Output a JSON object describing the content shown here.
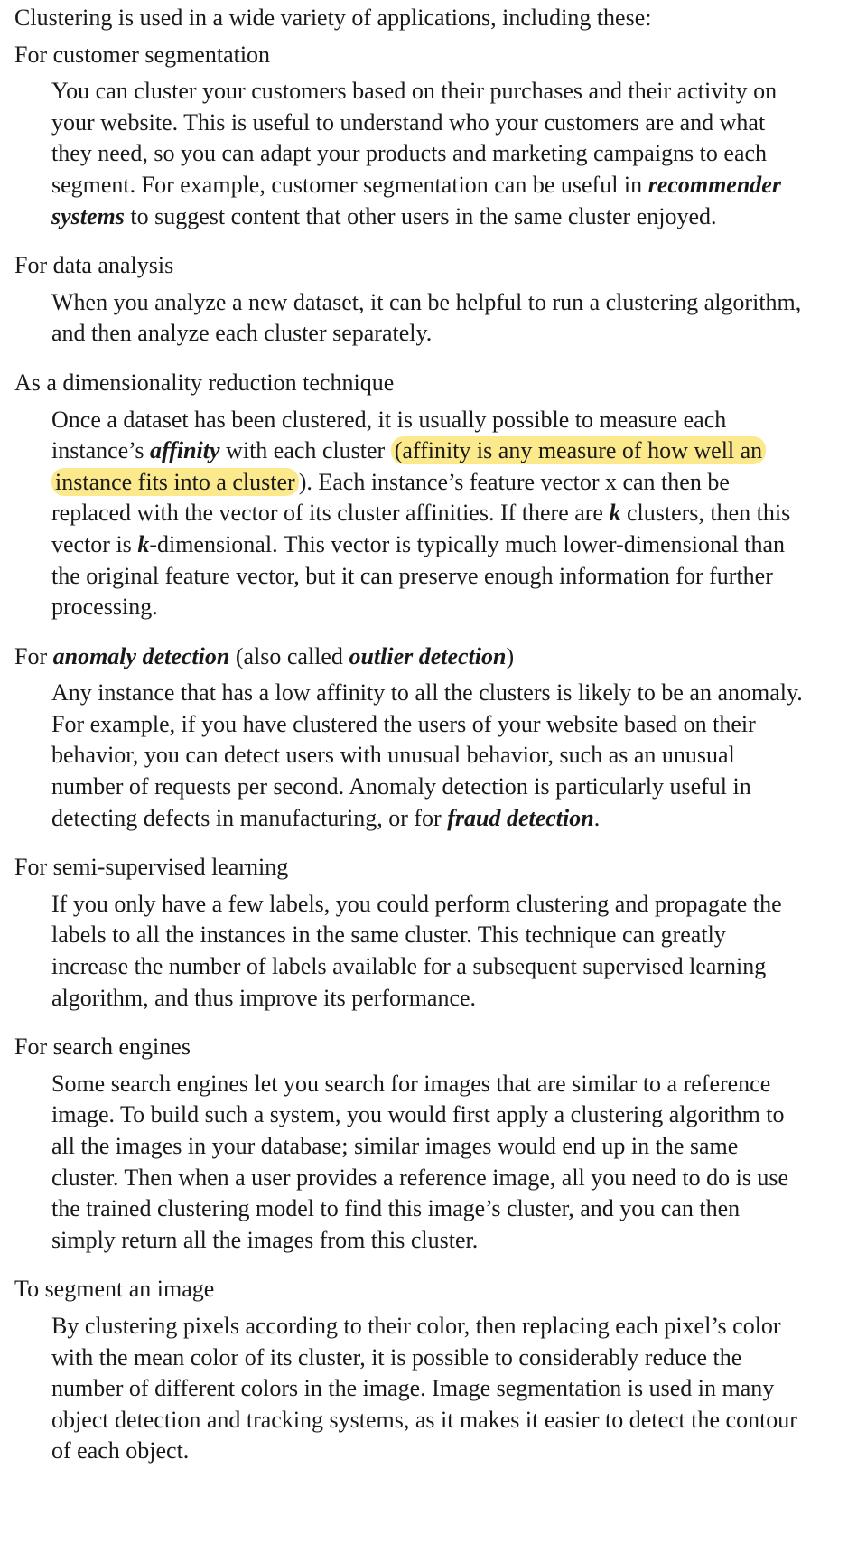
{
  "intro": "Clustering is used in a wide variety of applications, including these:",
  "sections": [
    {
      "term": "For customer segmentation",
      "def": {
        "t1": "You can cluster your customers based on their purchases and their activity on your website. This is useful to understand who your customers are and what they need, so you can adapt your products and marketing campaigns to each segment. For example, customer segmentation can be useful in ",
        "b1": "recommender systems",
        "t2": " to suggest content that other users in the same cluster enjoyed."
      }
    },
    {
      "term": "For data analysis",
      "def": {
        "t1": "When you analyze a new dataset, it can be helpful to run a clustering algorithm, and then analyze each cluster separately."
      }
    },
    {
      "term": "As a dimensionality reduction technique",
      "def": {
        "t1": "Once a dataset has been clustered, it is usually possible to measure each instance’s ",
        "b1": "affinity",
        "t2": " with each cluster ",
        "highlight": "(affinity is any measure of how well an instance fits into a cluster",
        "t3": "). Each instance’s feature vector x can then be replaced with the vector of its cluster affinities. If there are ",
        "b2": "k",
        "t4": " clusters, then this vector is ",
        "b3": "k",
        "t5": "-dimensional. This vector is typically much lower-dimensional than the original feature vector, but it can preserve enough information for further processing."
      }
    },
    {
      "term": {
        "t1": "For ",
        "b1": "anomaly detection",
        "t2": " (also called ",
        "b2": "outlier detection",
        "t3": ")"
      },
      "def": {
        "t1": "Any instance that has a low affinity to all the clusters is likely to be an anomaly. For example, if you have clustered the users of your website based on their behavior, you can detect users with unusual behavior, such as an unusual number of requests per second. Anomaly detection is particularly useful in detecting defects in manufacturing, or for ",
        "b1": "fraud detection",
        "t2": "."
      }
    },
    {
      "term": "For semi-supervised learning",
      "def": {
        "t1": "If you only have a few labels, you could perform clustering and propagate the labels to all the instances in the same cluster. This technique can greatly increase the number of labels available for a subsequent supervised learning algorithm, and thus improve its performance."
      }
    },
    {
      "term": "For search engines",
      "def": {
        "t1": "Some search engines let you search for images that are similar to a reference image. To build such a system, you would first apply a clustering algorithm to all the images in your database; similar images would end up in the same cluster. Then when a user provides a reference image, all you need to do is use the trained clustering model to find this image’s cluster, and you can then simply return all the images from this cluster."
      }
    },
    {
      "term": "To segment an image",
      "def": {
        "t1": "By clustering pixels according to their color, then replacing each pixel’s color with the mean color of its cluster, it is possible to considerably reduce the number of different colors in the image. Image segmentation is used in many object detection and tracking systems, as it makes it easier to detect the contour of each object."
      }
    }
  ],
  "colors": {
    "highlight": "#fbe98c",
    "text": "#1a1a1a"
  }
}
